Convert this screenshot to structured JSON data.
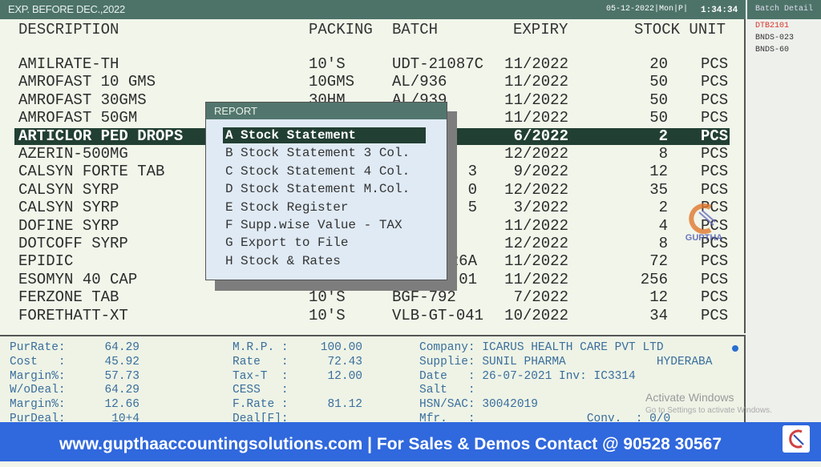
{
  "header": {
    "title": "EXP. BEFORE DEC.,2022",
    "datetime": "05-12-2022|Mon|P|",
    "clock": "1:34:34"
  },
  "columns": {
    "description": "DESCRIPTION",
    "packing": "PACKING",
    "batch": "BATCH",
    "expiry": "EXPIRY",
    "stock_unit": "STOCK UNIT"
  },
  "rows": [
    {
      "description": "AMILRATE-TH",
      "packing": "10'S",
      "batch": "UDT-21087C",
      "expiry": "11/2022",
      "stock": "20",
      "unit": "PCS"
    },
    {
      "description": "AMROFAST 10 GMS",
      "packing": "10GMS",
      "batch": "AL/936",
      "expiry": "11/2022",
      "stock": "50",
      "unit": "PCS"
    },
    {
      "description": "AMROFAST 30GMS",
      "packing": "30HM",
      "batch": "AL/939",
      "expiry": "11/2022",
      "stock": "50",
      "unit": "PCS"
    },
    {
      "description": "AMROFAST 50GM",
      "packing": "",
      "batch": "",
      "expiry": "11/2022",
      "stock": "50",
      "unit": "PCS"
    },
    {
      "description": "ARTICLOR PED DROPS",
      "packing": "",
      "batch": "",
      "expiry": "6/2022",
      "stock": "2",
      "unit": "PCS"
    },
    {
      "description": "AZERIN-500MG",
      "packing": "",
      "batch": "",
      "expiry": "12/2022",
      "stock": "8",
      "unit": "PCS"
    },
    {
      "description": "CALSYN FORTE TAB",
      "packing": "",
      "batch": "3",
      "expiry": "9/2022",
      "stock": "12",
      "unit": "PCS"
    },
    {
      "description": "CALSYN SYRP",
      "packing": "",
      "batch": "0",
      "expiry": "12/2022",
      "stock": "35",
      "unit": "PCS"
    },
    {
      "description": "CALSYN SYRP",
      "packing": "",
      "batch": "5",
      "expiry": "3/2022",
      "stock": "2",
      "unit": "PCS"
    },
    {
      "description": "DOFINE SYRP",
      "packing": "",
      "batch": "",
      "expiry": "11/2022",
      "stock": "4",
      "unit": "PCS"
    },
    {
      "description": "DOTCOFF SYRP",
      "packing": "",
      "batch": "",
      "expiry": "12/2022",
      "stock": "8",
      "unit": "PCS"
    },
    {
      "description": "EPIDIC",
      "packing": "",
      "batch": "26A",
      "expiry": "11/2022",
      "stock": "72",
      "unit": "PCS"
    },
    {
      "description": "ESOMYN 40 CAP",
      "packing": "",
      "batch": "01",
      "expiry": "11/2022",
      "stock": "256",
      "unit": "PCS"
    },
    {
      "description": "FERZONE TAB",
      "packing": "10'S",
      "batch": "BGF-792",
      "expiry": "7/2022",
      "stock": "12",
      "unit": "PCS"
    },
    {
      "description": "FORETHATT-XT",
      "packing": "10'S",
      "batch": "VLB-GT-041",
      "expiry": "10/2022",
      "stock": "34",
      "unit": "PCS"
    }
  ],
  "selected_row": 4,
  "report_menu": {
    "title": "REPORT",
    "items": [
      {
        "key": "A",
        "label": "Stock Statement"
      },
      {
        "key": "B",
        "label": "Stock Statement 3 Col."
      },
      {
        "key": "C",
        "label": "Stock Statement 4 Col."
      },
      {
        "key": "D",
        "label": "Stock Statement M.Col."
      },
      {
        "key": "E",
        "label": "Stock Register"
      },
      {
        "key": "F",
        "label": "Supp.wise Value - TAX"
      },
      {
        "key": "G",
        "label": "Export to File"
      },
      {
        "key": "H",
        "label": "Stock & Rates"
      }
    ],
    "selected": 0
  },
  "batch_detail": {
    "title": "Batch Detail",
    "items": [
      {
        "label": "DTB2101",
        "color": "#d9342b"
      },
      {
        "label": "BNDS-023",
        "color": "#333333"
      },
      {
        "label": "BNDS-60",
        "color": "#333333"
      }
    ]
  },
  "details": {
    "left": [
      [
        "PurRate:",
        "64.29"
      ],
      [
        "Cost   :",
        "45.92"
      ],
      [
        "Margin%:",
        "57.73"
      ],
      [
        "W/oDeal:",
        "64.29"
      ],
      [
        "Margin%:",
        "12.66"
      ],
      [
        "PurDeal:",
        "10+4"
      ]
    ],
    "middle": [
      [
        "M.R.P. :",
        "100.00"
      ],
      [
        "Rate   :",
        "72.43"
      ],
      [
        "Tax-T  :",
        "12.00"
      ],
      [
        "CESS   :",
        ""
      ],
      [
        "F.Rate :",
        "81.12"
      ],
      [
        "Deal[F]:",
        ""
      ]
    ],
    "right": [
      "Company: ICARUS HEALTH CARE PVT LTD",
      "Supplie: SUNIL PHARMA             HYDERABA",
      "Date   : 26-07-2021 Inv: IC3314",
      "Salt   :",
      "HSN/SAC: 30042019",
      "Mfr.   :                Conv.  : 0/0"
    ]
  },
  "watermark": {
    "line1": "Activate Windows",
    "line2": "Go to Settings to activate Windows."
  },
  "logo_text": "GUPTHA",
  "banner": "www.gupthaaccountingsolutions.com | For Sales & Demos Contact @ 90528 30567",
  "colors": {
    "header": "#4d7369",
    "selection": "#223f33",
    "banner": "#3068dd",
    "detail_text": "#3a6e9c"
  }
}
